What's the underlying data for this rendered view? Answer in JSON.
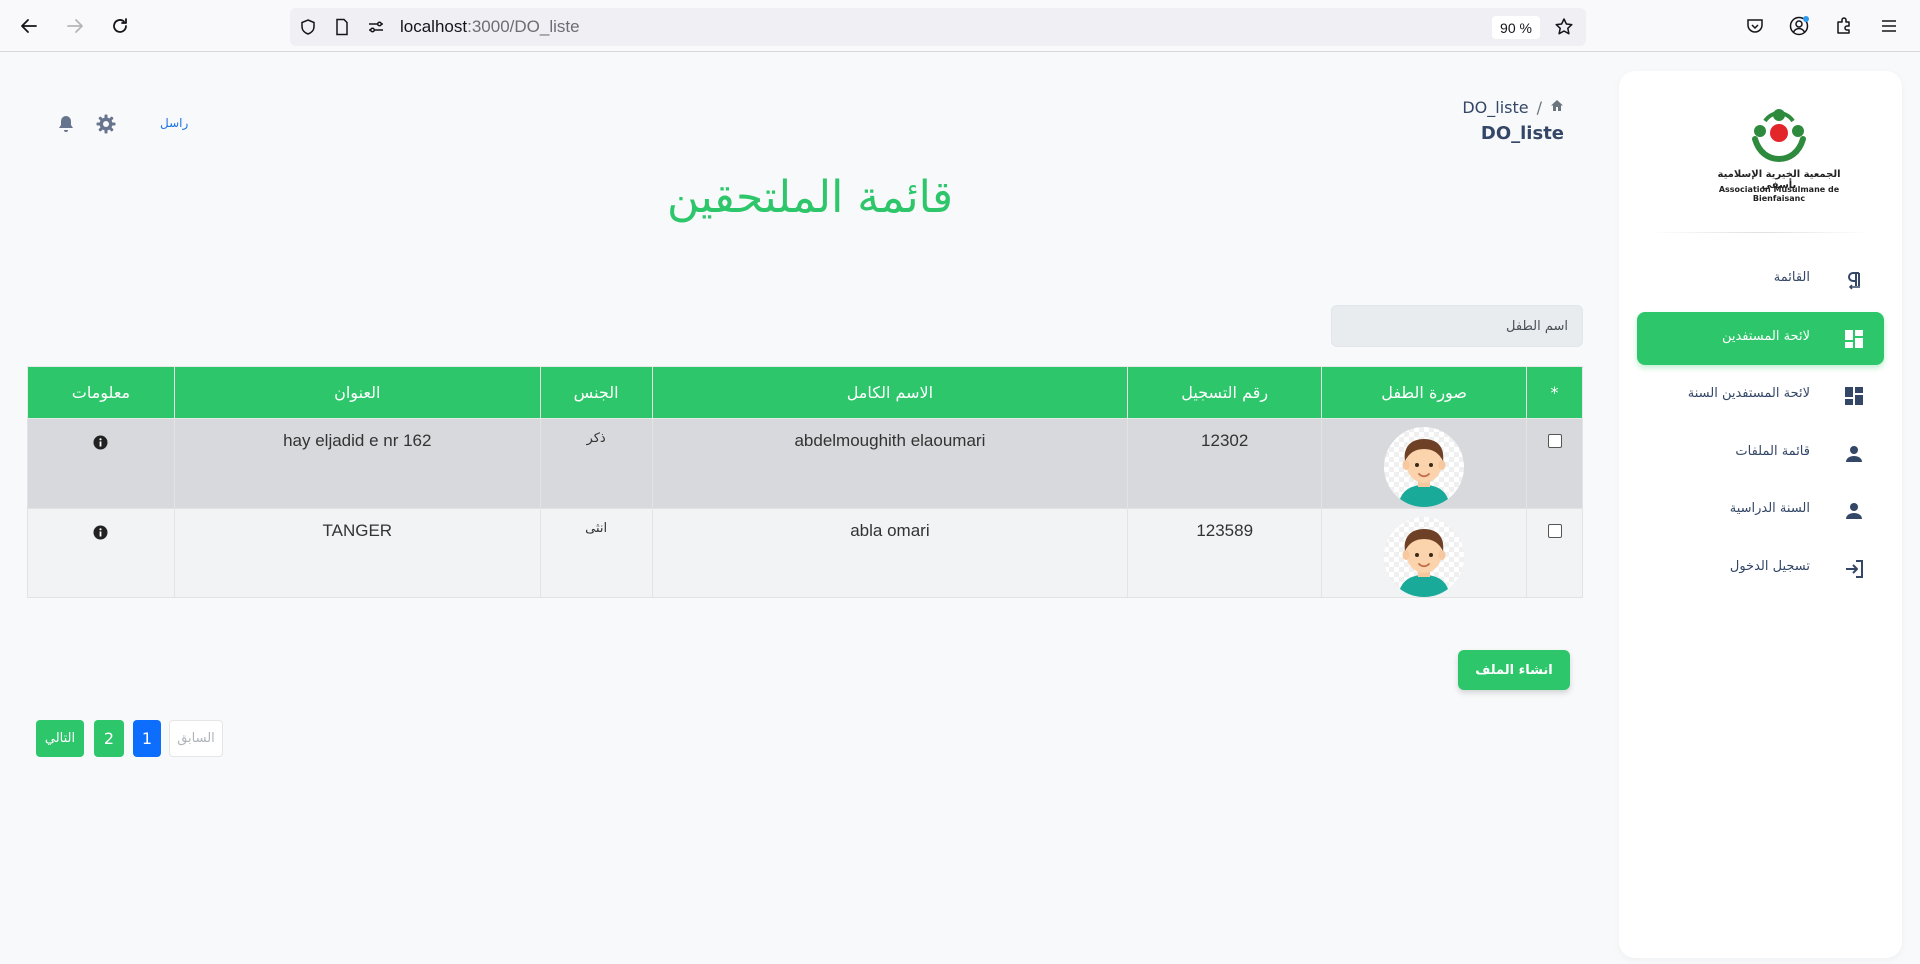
{
  "browser": {
    "url_host": "localhost",
    "url_path": ":3000/DO_liste",
    "zoom": "90 %"
  },
  "sidebar": {
    "logo": {
      "text_ar": "الجمعية الخيرية الإسلامية بأسفي",
      "text_fr": "Association Musulmane de Bienfaisanc"
    },
    "items": [
      {
        "label": "القائمة",
        "icon": "paragraph-icon"
      },
      {
        "label": "لائحة المستفدين",
        "icon": "dashboard-icon",
        "active": true
      },
      {
        "label": "لائحة المستفدين السنة",
        "icon": "dashboard-icon"
      },
      {
        "label": "قائمة الملفات",
        "icon": "user-icon"
      },
      {
        "label": "السنة الدراسية",
        "icon": "user-icon"
      },
      {
        "label": "تسجيل الدخول",
        "icon": "login-icon"
      }
    ]
  },
  "header": {
    "breadcrumb_current": "DO_liste",
    "page_subtitle": "DO_liste",
    "send_link": "راسل"
  },
  "main": {
    "title": "قائمة الملتحقين",
    "search_placeholder": "اسم الطفل"
  },
  "table": {
    "columns": [
      "*",
      "صورة الطفل",
      "رقم التسجيل",
      "الاسم الكامل",
      "الجنس",
      "العنوان",
      "معلومات"
    ],
    "rows": [
      {
        "registration": "12302",
        "full_name": "abdelmoughith elaoumari",
        "gender": "ذكر",
        "address": "hay eljadid e nr 162"
      },
      {
        "registration": "123589",
        "full_name": "abla omari",
        "gender": "انثى",
        "address": "TANGER"
      }
    ]
  },
  "actions": {
    "create_file": "انشاء الملف"
  },
  "pagination": {
    "prev": "السابق",
    "page1": "1",
    "page2": "2",
    "next": "التالي"
  },
  "colors": {
    "accent": "#2dc66a",
    "active_page": "#0d6efd"
  }
}
